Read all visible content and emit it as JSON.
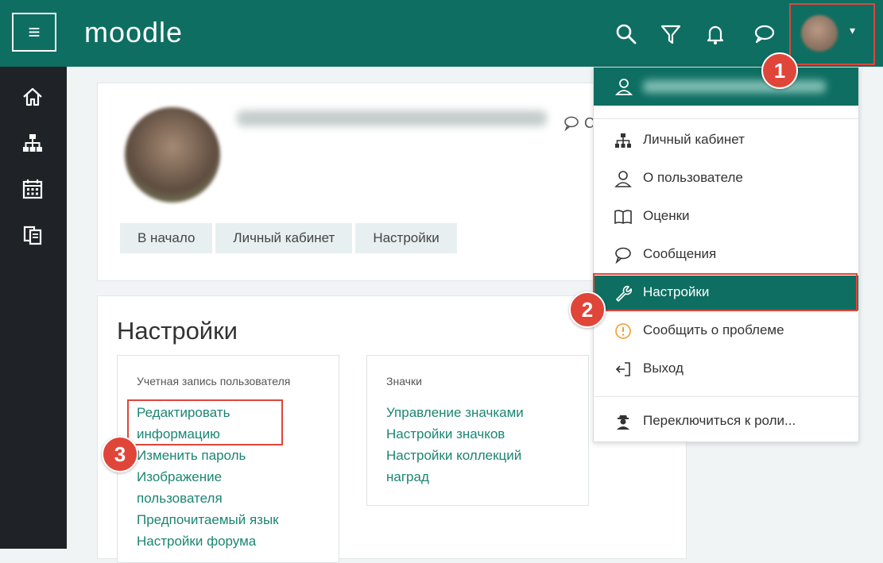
{
  "app": {
    "logo_text": "moodle"
  },
  "topbar": {
    "menu_icon": "hamburger-icon",
    "icons": [
      "search-icon",
      "filter-icon",
      "bell-icon",
      "chat-icon"
    ],
    "user_menu_caret": "▾"
  },
  "sidebar": {
    "icons": [
      "home-icon",
      "sitemap-icon",
      "calendar-icon",
      "files-icon"
    ]
  },
  "profile": {
    "breadcrumb": [
      "В начало",
      "Личный кабинет",
      "Настройки"
    ],
    "message_link_fragment": "С"
  },
  "settings": {
    "title": "Настройки",
    "account": {
      "title": "Учетная запись пользователя",
      "links": [
        "Редактировать",
        "информацию",
        "Изменить пароль",
        "Изображение",
        "пользователя",
        "Предпочитаемый язык",
        "Настройки форума"
      ]
    },
    "badges": {
      "title": "Значки",
      "links": [
        "Управление значками",
        "Настройки значков",
        "Настройки коллекций",
        "наград"
      ]
    }
  },
  "user_menu": {
    "items": [
      {
        "label": "Личный кабинет",
        "icon": "sitemap-icon"
      },
      {
        "label": "О пользователе",
        "icon": "user-icon"
      },
      {
        "label": "Оценки",
        "icon": "book-icon"
      },
      {
        "label": "Сообщения",
        "icon": "chat-icon"
      },
      {
        "label": "Настройки",
        "icon": "wrench-icon"
      },
      {
        "label": "Сообщить о проблеме",
        "icon": "warning-icon"
      },
      {
        "label": "Выход",
        "icon": "logout-icon"
      },
      {
        "label": "Переключиться к роли...",
        "icon": "user-secret-icon"
      }
    ],
    "active_index": 4
  },
  "annotations": {
    "badges": [
      "1",
      "2",
      "3"
    ]
  },
  "colors": {
    "brand": "#0e6e62",
    "highlight": "#e0453a",
    "link": "#1b8573"
  }
}
